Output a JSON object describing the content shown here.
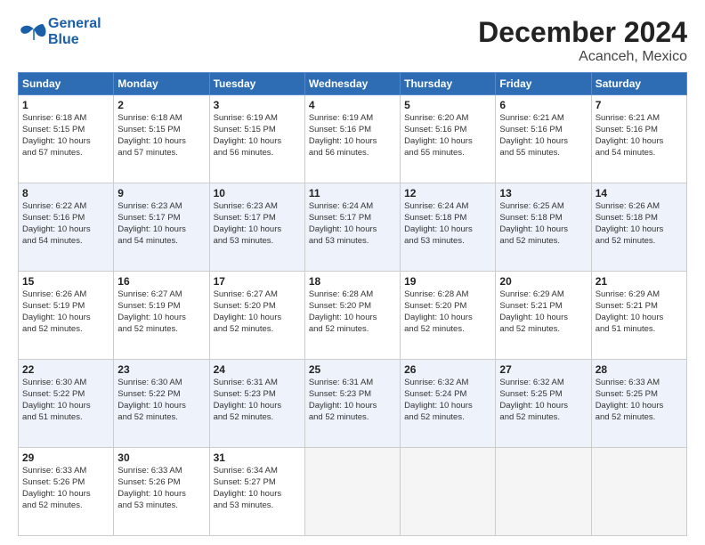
{
  "header": {
    "logo_line1": "General",
    "logo_line2": "Blue",
    "title": "December 2024",
    "subtitle": "Acanceh, Mexico"
  },
  "days_of_week": [
    "Sunday",
    "Monday",
    "Tuesday",
    "Wednesday",
    "Thursday",
    "Friday",
    "Saturday"
  ],
  "weeks": [
    [
      {
        "day": 1,
        "lines": [
          "Sunrise: 6:18 AM",
          "Sunset: 5:15 PM",
          "Daylight: 10 hours",
          "and 57 minutes."
        ]
      },
      {
        "day": 2,
        "lines": [
          "Sunrise: 6:18 AM",
          "Sunset: 5:15 PM",
          "Daylight: 10 hours",
          "and 57 minutes."
        ]
      },
      {
        "day": 3,
        "lines": [
          "Sunrise: 6:19 AM",
          "Sunset: 5:15 PM",
          "Daylight: 10 hours",
          "and 56 minutes."
        ]
      },
      {
        "day": 4,
        "lines": [
          "Sunrise: 6:19 AM",
          "Sunset: 5:16 PM",
          "Daylight: 10 hours",
          "and 56 minutes."
        ]
      },
      {
        "day": 5,
        "lines": [
          "Sunrise: 6:20 AM",
          "Sunset: 5:16 PM",
          "Daylight: 10 hours",
          "and 55 minutes."
        ]
      },
      {
        "day": 6,
        "lines": [
          "Sunrise: 6:21 AM",
          "Sunset: 5:16 PM",
          "Daylight: 10 hours",
          "and 55 minutes."
        ]
      },
      {
        "day": 7,
        "lines": [
          "Sunrise: 6:21 AM",
          "Sunset: 5:16 PM",
          "Daylight: 10 hours",
          "and 54 minutes."
        ]
      }
    ],
    [
      {
        "day": 8,
        "lines": [
          "Sunrise: 6:22 AM",
          "Sunset: 5:16 PM",
          "Daylight: 10 hours",
          "and 54 minutes."
        ]
      },
      {
        "day": 9,
        "lines": [
          "Sunrise: 6:23 AM",
          "Sunset: 5:17 PM",
          "Daylight: 10 hours",
          "and 54 minutes."
        ]
      },
      {
        "day": 10,
        "lines": [
          "Sunrise: 6:23 AM",
          "Sunset: 5:17 PM",
          "Daylight: 10 hours",
          "and 53 minutes."
        ]
      },
      {
        "day": 11,
        "lines": [
          "Sunrise: 6:24 AM",
          "Sunset: 5:17 PM",
          "Daylight: 10 hours",
          "and 53 minutes."
        ]
      },
      {
        "day": 12,
        "lines": [
          "Sunrise: 6:24 AM",
          "Sunset: 5:18 PM",
          "Daylight: 10 hours",
          "and 53 minutes."
        ]
      },
      {
        "day": 13,
        "lines": [
          "Sunrise: 6:25 AM",
          "Sunset: 5:18 PM",
          "Daylight: 10 hours",
          "and 52 minutes."
        ]
      },
      {
        "day": 14,
        "lines": [
          "Sunrise: 6:26 AM",
          "Sunset: 5:18 PM",
          "Daylight: 10 hours",
          "and 52 minutes."
        ]
      }
    ],
    [
      {
        "day": 15,
        "lines": [
          "Sunrise: 6:26 AM",
          "Sunset: 5:19 PM",
          "Daylight: 10 hours",
          "and 52 minutes."
        ]
      },
      {
        "day": 16,
        "lines": [
          "Sunrise: 6:27 AM",
          "Sunset: 5:19 PM",
          "Daylight: 10 hours",
          "and 52 minutes."
        ]
      },
      {
        "day": 17,
        "lines": [
          "Sunrise: 6:27 AM",
          "Sunset: 5:20 PM",
          "Daylight: 10 hours",
          "and 52 minutes."
        ]
      },
      {
        "day": 18,
        "lines": [
          "Sunrise: 6:28 AM",
          "Sunset: 5:20 PM",
          "Daylight: 10 hours",
          "and 52 minutes."
        ]
      },
      {
        "day": 19,
        "lines": [
          "Sunrise: 6:28 AM",
          "Sunset: 5:20 PM",
          "Daylight: 10 hours",
          "and 52 minutes."
        ]
      },
      {
        "day": 20,
        "lines": [
          "Sunrise: 6:29 AM",
          "Sunset: 5:21 PM",
          "Daylight: 10 hours",
          "and 52 minutes."
        ]
      },
      {
        "day": 21,
        "lines": [
          "Sunrise: 6:29 AM",
          "Sunset: 5:21 PM",
          "Daylight: 10 hours",
          "and 51 minutes."
        ]
      }
    ],
    [
      {
        "day": 22,
        "lines": [
          "Sunrise: 6:30 AM",
          "Sunset: 5:22 PM",
          "Daylight: 10 hours",
          "and 51 minutes."
        ]
      },
      {
        "day": 23,
        "lines": [
          "Sunrise: 6:30 AM",
          "Sunset: 5:22 PM",
          "Daylight: 10 hours",
          "and 52 minutes."
        ]
      },
      {
        "day": 24,
        "lines": [
          "Sunrise: 6:31 AM",
          "Sunset: 5:23 PM",
          "Daylight: 10 hours",
          "and 52 minutes."
        ]
      },
      {
        "day": 25,
        "lines": [
          "Sunrise: 6:31 AM",
          "Sunset: 5:23 PM",
          "Daylight: 10 hours",
          "and 52 minutes."
        ]
      },
      {
        "day": 26,
        "lines": [
          "Sunrise: 6:32 AM",
          "Sunset: 5:24 PM",
          "Daylight: 10 hours",
          "and 52 minutes."
        ]
      },
      {
        "day": 27,
        "lines": [
          "Sunrise: 6:32 AM",
          "Sunset: 5:25 PM",
          "Daylight: 10 hours",
          "and 52 minutes."
        ]
      },
      {
        "day": 28,
        "lines": [
          "Sunrise: 6:33 AM",
          "Sunset: 5:25 PM",
          "Daylight: 10 hours",
          "and 52 minutes."
        ]
      }
    ],
    [
      {
        "day": 29,
        "lines": [
          "Sunrise: 6:33 AM",
          "Sunset: 5:26 PM",
          "Daylight: 10 hours",
          "and 52 minutes."
        ]
      },
      {
        "day": 30,
        "lines": [
          "Sunrise: 6:33 AM",
          "Sunset: 5:26 PM",
          "Daylight: 10 hours",
          "and 53 minutes."
        ]
      },
      {
        "day": 31,
        "lines": [
          "Sunrise: 6:34 AM",
          "Sunset: 5:27 PM",
          "Daylight: 10 hours",
          "and 53 minutes."
        ]
      },
      null,
      null,
      null,
      null
    ]
  ]
}
